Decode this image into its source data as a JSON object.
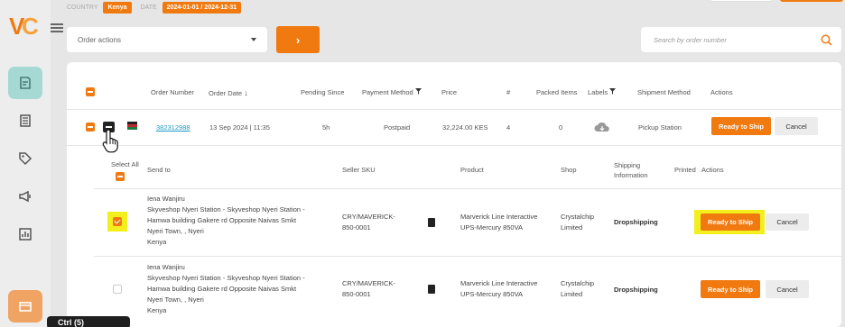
{
  "filters": {
    "country_label": "COUNTRY",
    "country_value": "Kenya",
    "date_label": "DATE",
    "date_value": "2024-01-01 / 2024-12-31"
  },
  "toolbar": {
    "order_actions_placeholder": "Order actions",
    "go_label": "›",
    "search_placeholder": "Search by order number"
  },
  "colors": {
    "accent": "#f07a10",
    "accent_light": "#f5a23b",
    "link": "#1e9ac2",
    "sidebar_active": "#a6d9d4",
    "highlight": "#f3ef1c"
  },
  "sidebar": {
    "icons": [
      "orders-icon",
      "list-icon",
      "tag-icon",
      "megaphone-icon",
      "chart-icon",
      "store-icon"
    ]
  },
  "table": {
    "columns": [
      "Order Number",
      "Order Date",
      "Pending Since",
      "Payment Method",
      "Price",
      "#",
      "Packed Items",
      "Labels",
      "Shipment Method",
      "Actions"
    ],
    "order": {
      "number": "382312988",
      "date": "13 Sep 2024 | 11:35",
      "pending": "5h",
      "payment": "Postpaid",
      "price": "32,224.00 KES",
      "count": "4",
      "packed": "0",
      "shipment": "Pickup Station",
      "ship_label": "Ready to Ship",
      "cancel_label": "Cancel"
    }
  },
  "subtable": {
    "select_all": "Select All",
    "columns": [
      "Send to",
      "Seller SKU",
      "Product",
      "Shop",
      "Shipping Information",
      "Printed",
      "Actions"
    ],
    "items": [
      {
        "addr": [
          "Iena Wanjiru",
          "Skyveshop Nyeri Station - Skyveshop Nyeri Station -",
          "Hamwa building Gakere rd Opposite Naivas Smkt",
          "Nyeri Town, , Nyeri",
          "Kenya"
        ],
        "sku": [
          "CRY/MAVERICK-",
          "850-0001"
        ],
        "product": [
          "Marverick Line Interactive",
          "UPS-Mercury 850VA"
        ],
        "shop": [
          "Crystalchip",
          "Limited"
        ],
        "shipping": "Dropshipping",
        "ship_label": "Ready to Ship",
        "cancel_label": "Cancel"
      },
      {
        "addr": [
          "Iena Wanjiru",
          "Skyveshop Nyeri Station - Skyveshop Nyeri Station -",
          "Hamwa building Gakere rd Opposite Naivas Smkt",
          "Nyeri Town, , Nyeri",
          "Kenya"
        ],
        "sku": [
          "CRY/MAVERICK-",
          "850-0001"
        ],
        "product": [
          "Marverick Line Interactive",
          "UPS-Mercury 850VA"
        ],
        "shop": [
          "Crystalchip",
          "Limited"
        ],
        "shipping": "Dropshipping",
        "ship_label": "Ready to Ship",
        "cancel_label": "Cancel"
      }
    ]
  },
  "tooltip": "Ctrl (5)"
}
